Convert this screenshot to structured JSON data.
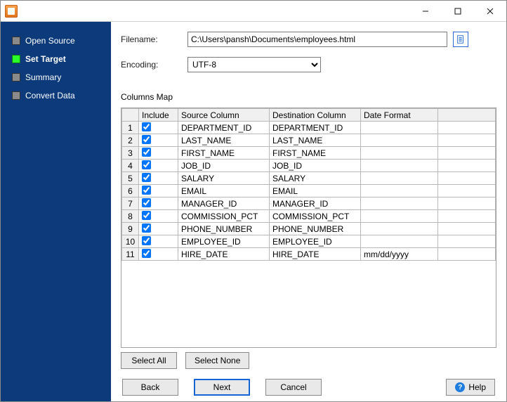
{
  "titlebar": {
    "appicon_name": "app-icon"
  },
  "sidebar": {
    "items": [
      {
        "id": "open-source",
        "label": "Open Source",
        "active": false
      },
      {
        "id": "set-target",
        "label": "Set Target",
        "active": true
      },
      {
        "id": "summary",
        "label": "Summary",
        "active": false
      },
      {
        "id": "convert-data",
        "label": "Convert Data",
        "active": false
      }
    ]
  },
  "form": {
    "filename_label": "Filename:",
    "filename_value": "C:\\Users\\pansh\\Documents\\employees.html",
    "encoding_label": "Encoding:",
    "encoding_value": "UTF-8",
    "columns_map_label": "Columns Map"
  },
  "grid": {
    "headers": {
      "include": "Include",
      "source": "Source Column",
      "dest": "Destination Column",
      "format": "Date Format"
    },
    "rows": [
      {
        "n": "1",
        "include": true,
        "src": "DEPARTMENT_ID",
        "dst": "DEPARTMENT_ID",
        "fmt": ""
      },
      {
        "n": "2",
        "include": true,
        "src": "LAST_NAME",
        "dst": "LAST_NAME",
        "fmt": ""
      },
      {
        "n": "3",
        "include": true,
        "src": "FIRST_NAME",
        "dst": "FIRST_NAME",
        "fmt": ""
      },
      {
        "n": "4",
        "include": true,
        "src": "JOB_ID",
        "dst": "JOB_ID",
        "fmt": ""
      },
      {
        "n": "5",
        "include": true,
        "src": "SALARY",
        "dst": "SALARY",
        "fmt": ""
      },
      {
        "n": "6",
        "include": true,
        "src": "EMAIL",
        "dst": "EMAIL",
        "fmt": ""
      },
      {
        "n": "7",
        "include": true,
        "src": "MANAGER_ID",
        "dst": "MANAGER_ID",
        "fmt": ""
      },
      {
        "n": "8",
        "include": true,
        "src": "COMMISSION_PCT",
        "dst": "COMMISSION_PCT",
        "fmt": ""
      },
      {
        "n": "9",
        "include": true,
        "src": "PHONE_NUMBER",
        "dst": "PHONE_NUMBER",
        "fmt": ""
      },
      {
        "n": "10",
        "include": true,
        "src": "EMPLOYEE_ID",
        "dst": "EMPLOYEE_ID",
        "fmt": ""
      },
      {
        "n": "11",
        "include": true,
        "src": "HIRE_DATE",
        "dst": "HIRE_DATE",
        "fmt": "mm/dd/yyyy"
      }
    ]
  },
  "buttons": {
    "select_all": "Select All",
    "select_none": "Select None",
    "back": "Back",
    "next": "Next",
    "cancel": "Cancel",
    "help": "Help"
  }
}
